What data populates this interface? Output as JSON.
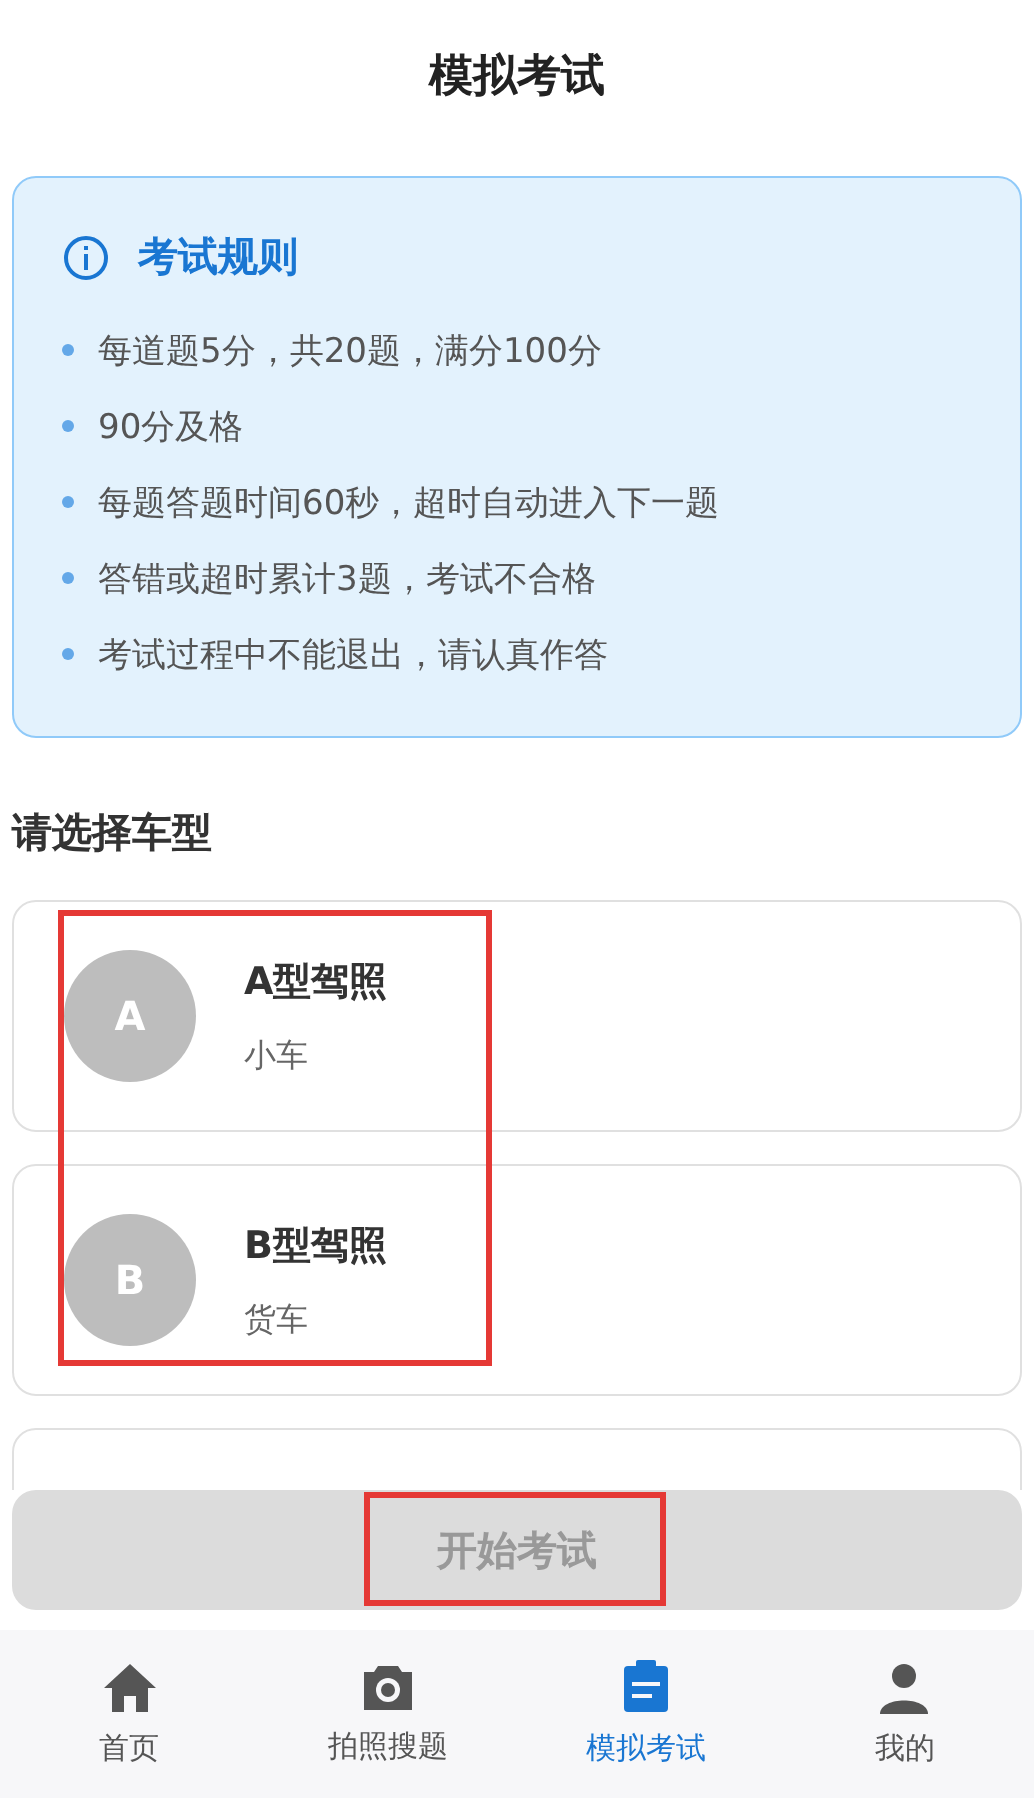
{
  "header": {
    "title": "模拟考试"
  },
  "rules": {
    "title": "考试规则",
    "items": [
      "每道题5分，共20题，满分100分",
      "90分及格",
      "每题答题时间60秒，超时自动进入下一题",
      "答错或超时累计3题，考试不合格",
      "考试过程中不能退出，请认真作答"
    ]
  },
  "vehicle_section": {
    "title": "请选择车型",
    "highlighted": true,
    "vehicles": [
      {
        "letter": "A",
        "name": "A型驾照",
        "type": "小车",
        "selected": false
      },
      {
        "letter": "B",
        "name": "B型驾照",
        "type": "货车",
        "selected": false
      }
    ]
  },
  "start_button": {
    "label": "开始考试",
    "disabled": true,
    "highlighted": true
  },
  "nav": [
    {
      "kind": "home",
      "label": "首页",
      "selected": false
    },
    {
      "kind": "camera",
      "label": "拍照搜题",
      "selected": false
    },
    {
      "kind": "exam",
      "label": "模拟考试",
      "selected": true
    },
    {
      "kind": "profile",
      "label": "我的",
      "selected": false
    }
  ]
}
